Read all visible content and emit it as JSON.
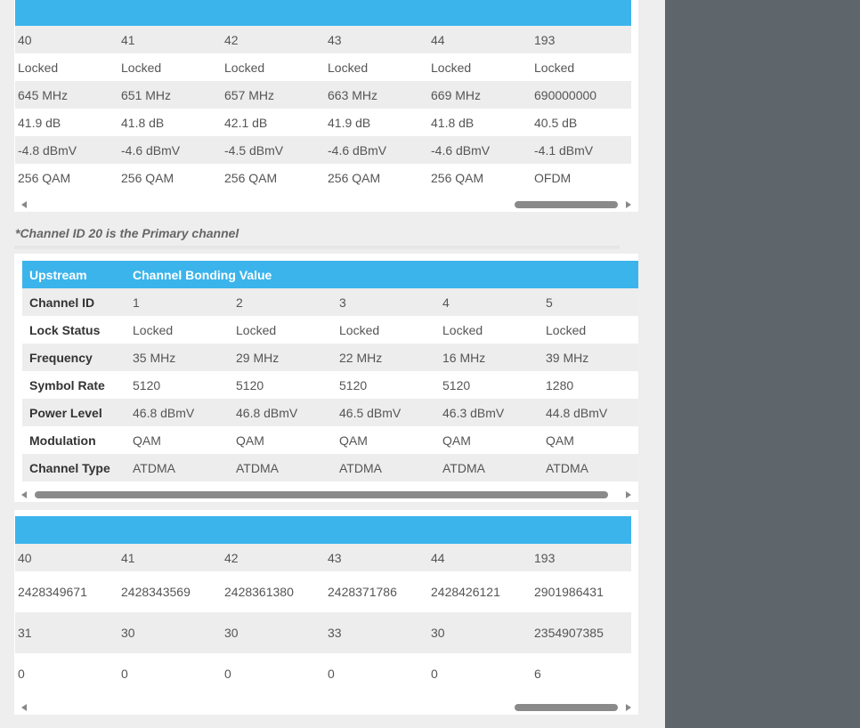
{
  "downstream_table": {
    "rows": [
      [
        "40",
        "41",
        "42",
        "43",
        "44",
        "193"
      ],
      [
        "Locked",
        "Locked",
        "Locked",
        "Locked",
        "Locked",
        "Locked"
      ],
      [
        "645 MHz",
        "651 MHz",
        "657 MHz",
        "663 MHz",
        "669 MHz",
        "690000000"
      ],
      [
        "41.9 dB",
        "41.8 dB",
        "42.1 dB",
        "41.9 dB",
        "41.8 dB",
        "40.5 dB"
      ],
      [
        "-4.8 dBmV",
        "-4.6 dBmV",
        "-4.5 dBmV",
        "-4.6 dBmV",
        "-4.6 dBmV",
        "-4.1 dBmV"
      ],
      [
        "256 QAM",
        "256 QAM",
        "256 QAM",
        "256 QAM",
        "256 QAM",
        "OFDM"
      ]
    ]
  },
  "primary_note": "*Channel ID 20 is the Primary channel",
  "upstream_table": {
    "header": {
      "label": "Upstream",
      "value": "Channel Bonding Value"
    },
    "rows": [
      {
        "label": "Channel ID",
        "values": [
          "1",
          "2",
          "3",
          "4",
          "5"
        ]
      },
      {
        "label": "Lock Status",
        "values": [
          "Locked",
          "Locked",
          "Locked",
          "Locked",
          "Locked"
        ]
      },
      {
        "label": "Frequency",
        "values": [
          "35 MHz",
          "29 MHz",
          "22 MHz",
          "16 MHz",
          "39 MHz"
        ]
      },
      {
        "label": "Symbol Rate",
        "values": [
          "5120",
          "5120",
          "5120",
          "5120",
          "1280"
        ]
      },
      {
        "label": "Power Level",
        "values": [
          "46.8 dBmV",
          "46.8 dBmV",
          "46.5 dBmV",
          "46.3 dBmV",
          "44.8 dBmV"
        ]
      },
      {
        "label": "Modulation",
        "values": [
          "QAM",
          "QAM",
          "QAM",
          "QAM",
          "QAM"
        ]
      },
      {
        "label": "Channel Type",
        "values": [
          "ATDMA",
          "ATDMA",
          "ATDMA",
          "ATDMA",
          "ATDMA"
        ]
      }
    ]
  },
  "codeword_table": {
    "rows": [
      [
        "40",
        "41",
        "42",
        "43",
        "44",
        "193"
      ],
      [
        "2428349671",
        "2428343569",
        "2428361380",
        "2428371786",
        "2428426121",
        "2901986431"
      ],
      [
        "31",
        "30",
        "30",
        "33",
        "30",
        "2354907385"
      ],
      [
        "0",
        "0",
        "0",
        "0",
        "0",
        "6"
      ]
    ]
  },
  "colors": {
    "header_bg": "#3bb4ec",
    "side_panel": "#5f666b",
    "alt_row": "#ededed"
  }
}
